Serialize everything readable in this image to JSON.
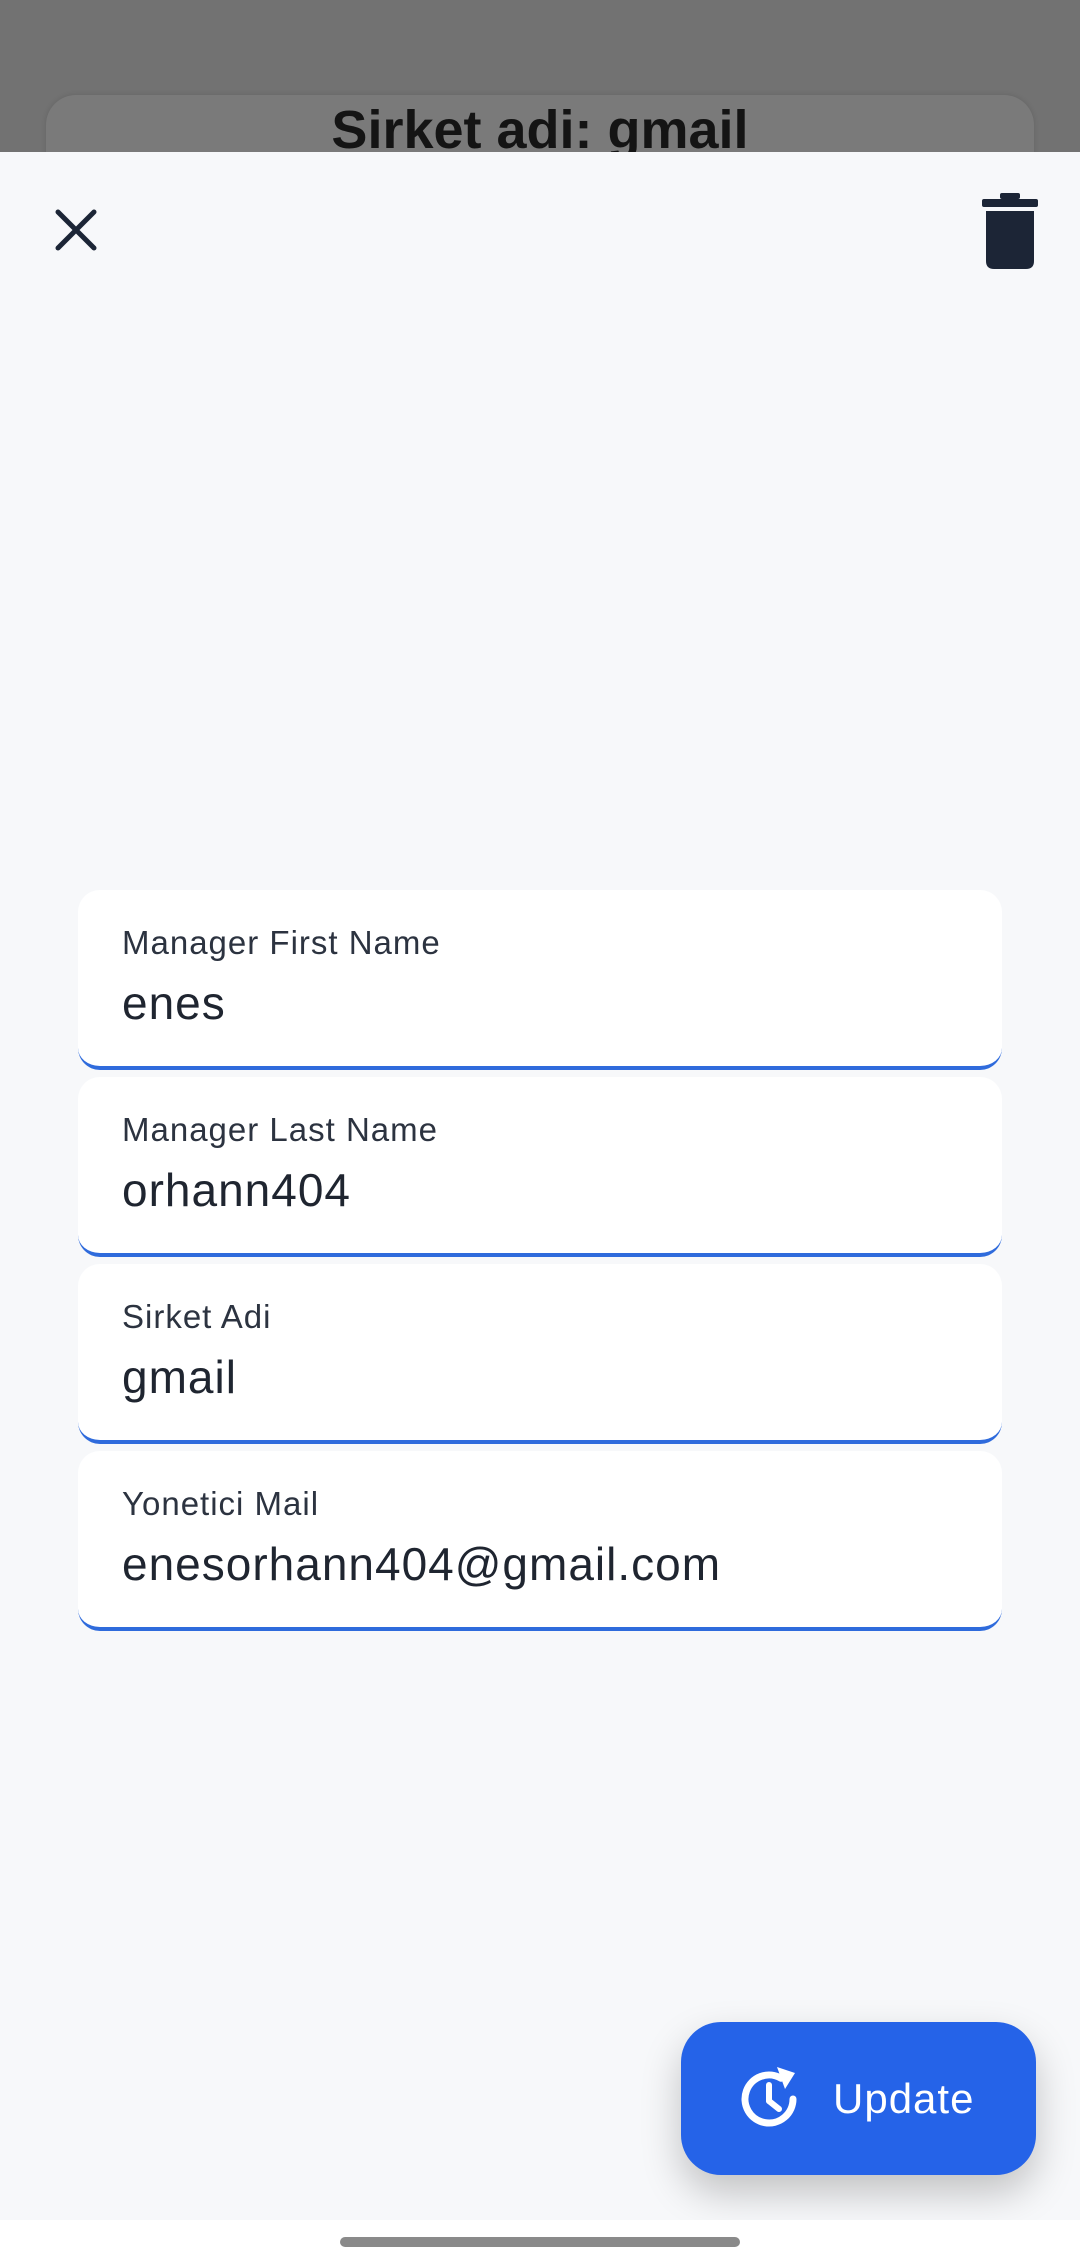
{
  "background": {
    "title": "Sirket adi: gmail"
  },
  "toolbar": {
    "close_icon": "close-icon",
    "delete_icon": "trash-icon"
  },
  "form": {
    "fields": [
      {
        "label": "Manager First Name",
        "value": "enes"
      },
      {
        "label": "Manager Last Name",
        "value": "orhann404"
      },
      {
        "label": "Sirket Adi",
        "value": "gmail"
      },
      {
        "label": "Yonetici Mail",
        "value": "enesorhann404@gmail.com"
      }
    ]
  },
  "update_button": {
    "label": "Update",
    "icon": "update-clock-icon"
  },
  "colors": {
    "accent": "#2563e8",
    "field_underline": "#2f6bdc",
    "icon": "#1c2536"
  }
}
